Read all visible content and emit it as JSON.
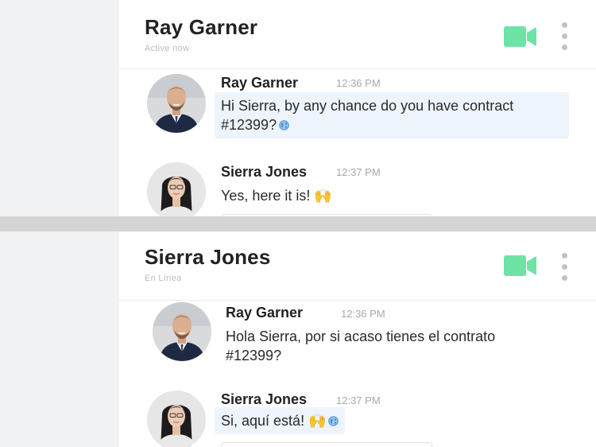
{
  "top_panel": {
    "header": {
      "name": "Ray Garner",
      "status": "Active now"
    },
    "messages": [
      {
        "sender": "Ray Garner",
        "time": "12:36 PM",
        "text_line1": "Hi Sierra, by any chance do you have contract",
        "text_line2": "#12399?"
      },
      {
        "sender": "Sierra Jones",
        "time": "12:37 PM",
        "text": "Yes, here it is! 🙌"
      }
    ]
  },
  "bottom_panel": {
    "header": {
      "name": "Sierra Jones",
      "status": "En Línea"
    },
    "messages": [
      {
        "sender": "Ray Garner",
        "time": "12:36 PM",
        "text_line1": "Hola Sierra, por si acaso tienes el contrato",
        "text_line2": "#12399?"
      },
      {
        "sender": "Sierra Jones",
        "time": "12:37 PM",
        "text": "Si, aquí está! 🙌"
      }
    ]
  },
  "colors": {
    "accent": "#6fe3a6",
    "bubble_highlight": "#eef4fb",
    "sidebar": "#f1f2f4",
    "divider": "#d4d4d4"
  },
  "icons": {
    "video": "video-camera-icon",
    "more": "more-vertical-icon",
    "translate": "globe-icon"
  }
}
